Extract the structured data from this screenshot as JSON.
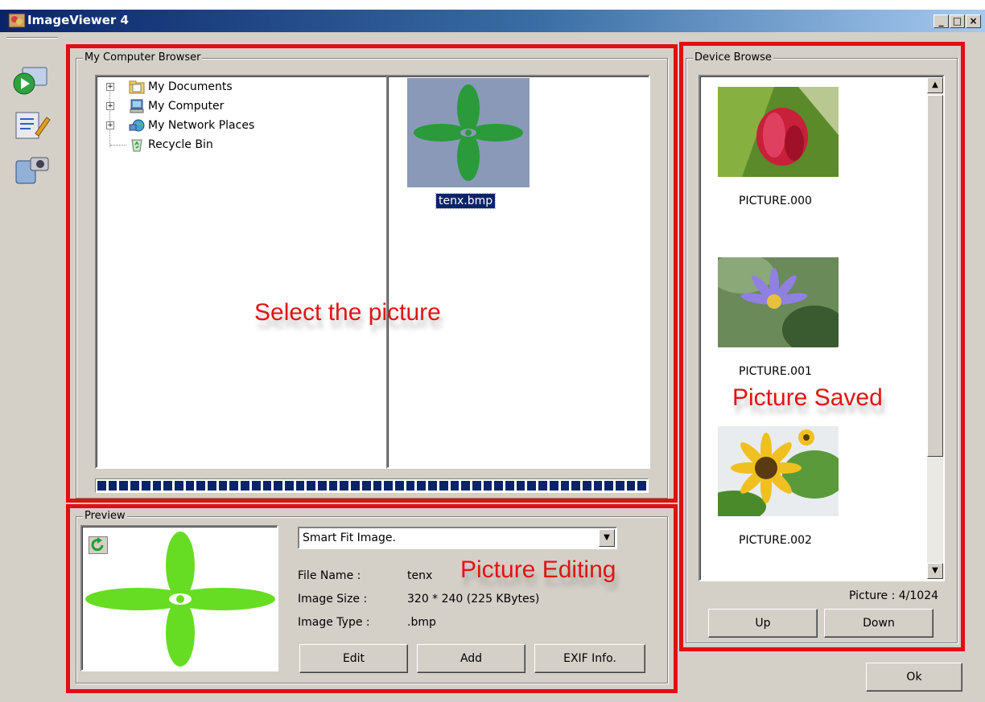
{
  "window": {
    "title": "ImageViewer 4",
    "minimize": "_",
    "maximize": "□",
    "close": "×"
  },
  "toolbar": {
    "icons": [
      "play-media-icon",
      "edit-document-icon",
      "device-camera-icon"
    ]
  },
  "computer_browser": {
    "label": "My Computer Browser",
    "tree": [
      {
        "label": "My Documents",
        "icon": "documents-folder-icon",
        "expandable": true
      },
      {
        "label": "My Computer",
        "icon": "computer-icon",
        "expandable": true
      },
      {
        "label": "My Network Places",
        "icon": "network-places-icon",
        "expandable": true
      },
      {
        "label": "Recycle Bin",
        "icon": "recycle-bin-icon",
        "expandable": false
      }
    ],
    "selected_file": {
      "name": "tenx.bmp"
    }
  },
  "device_browse": {
    "label": "Device Browse",
    "pictures": [
      {
        "name": "PICTURE.000"
      },
      {
        "name": "PICTURE.001"
      },
      {
        "name": "PICTURE.002"
      }
    ],
    "counter": "Picture : 4/1024",
    "up_label": "Up",
    "down_label": "Down"
  },
  "preview": {
    "label": "Preview",
    "fit_mode": "Smart Fit Image.",
    "file_name_label": "File Name :",
    "file_name": "tenx",
    "image_size_label": "Image Size :",
    "image_size": "320 * 240 (225 KBytes)",
    "image_type_label": "Image Type :",
    "image_type": ".bmp",
    "edit_label": "Edit",
    "add_label": "Add",
    "exif_label": "EXIF Info."
  },
  "annotations": {
    "select": "Select the picture",
    "saved": "Picture Saved",
    "editing": "Picture Editing"
  },
  "ok_label": "Ok",
  "colors": {
    "annotation_red": "#e01010",
    "titlebar": "#0a246a",
    "window_bg": "#d4d0c8",
    "selection": "#0a246a"
  }
}
